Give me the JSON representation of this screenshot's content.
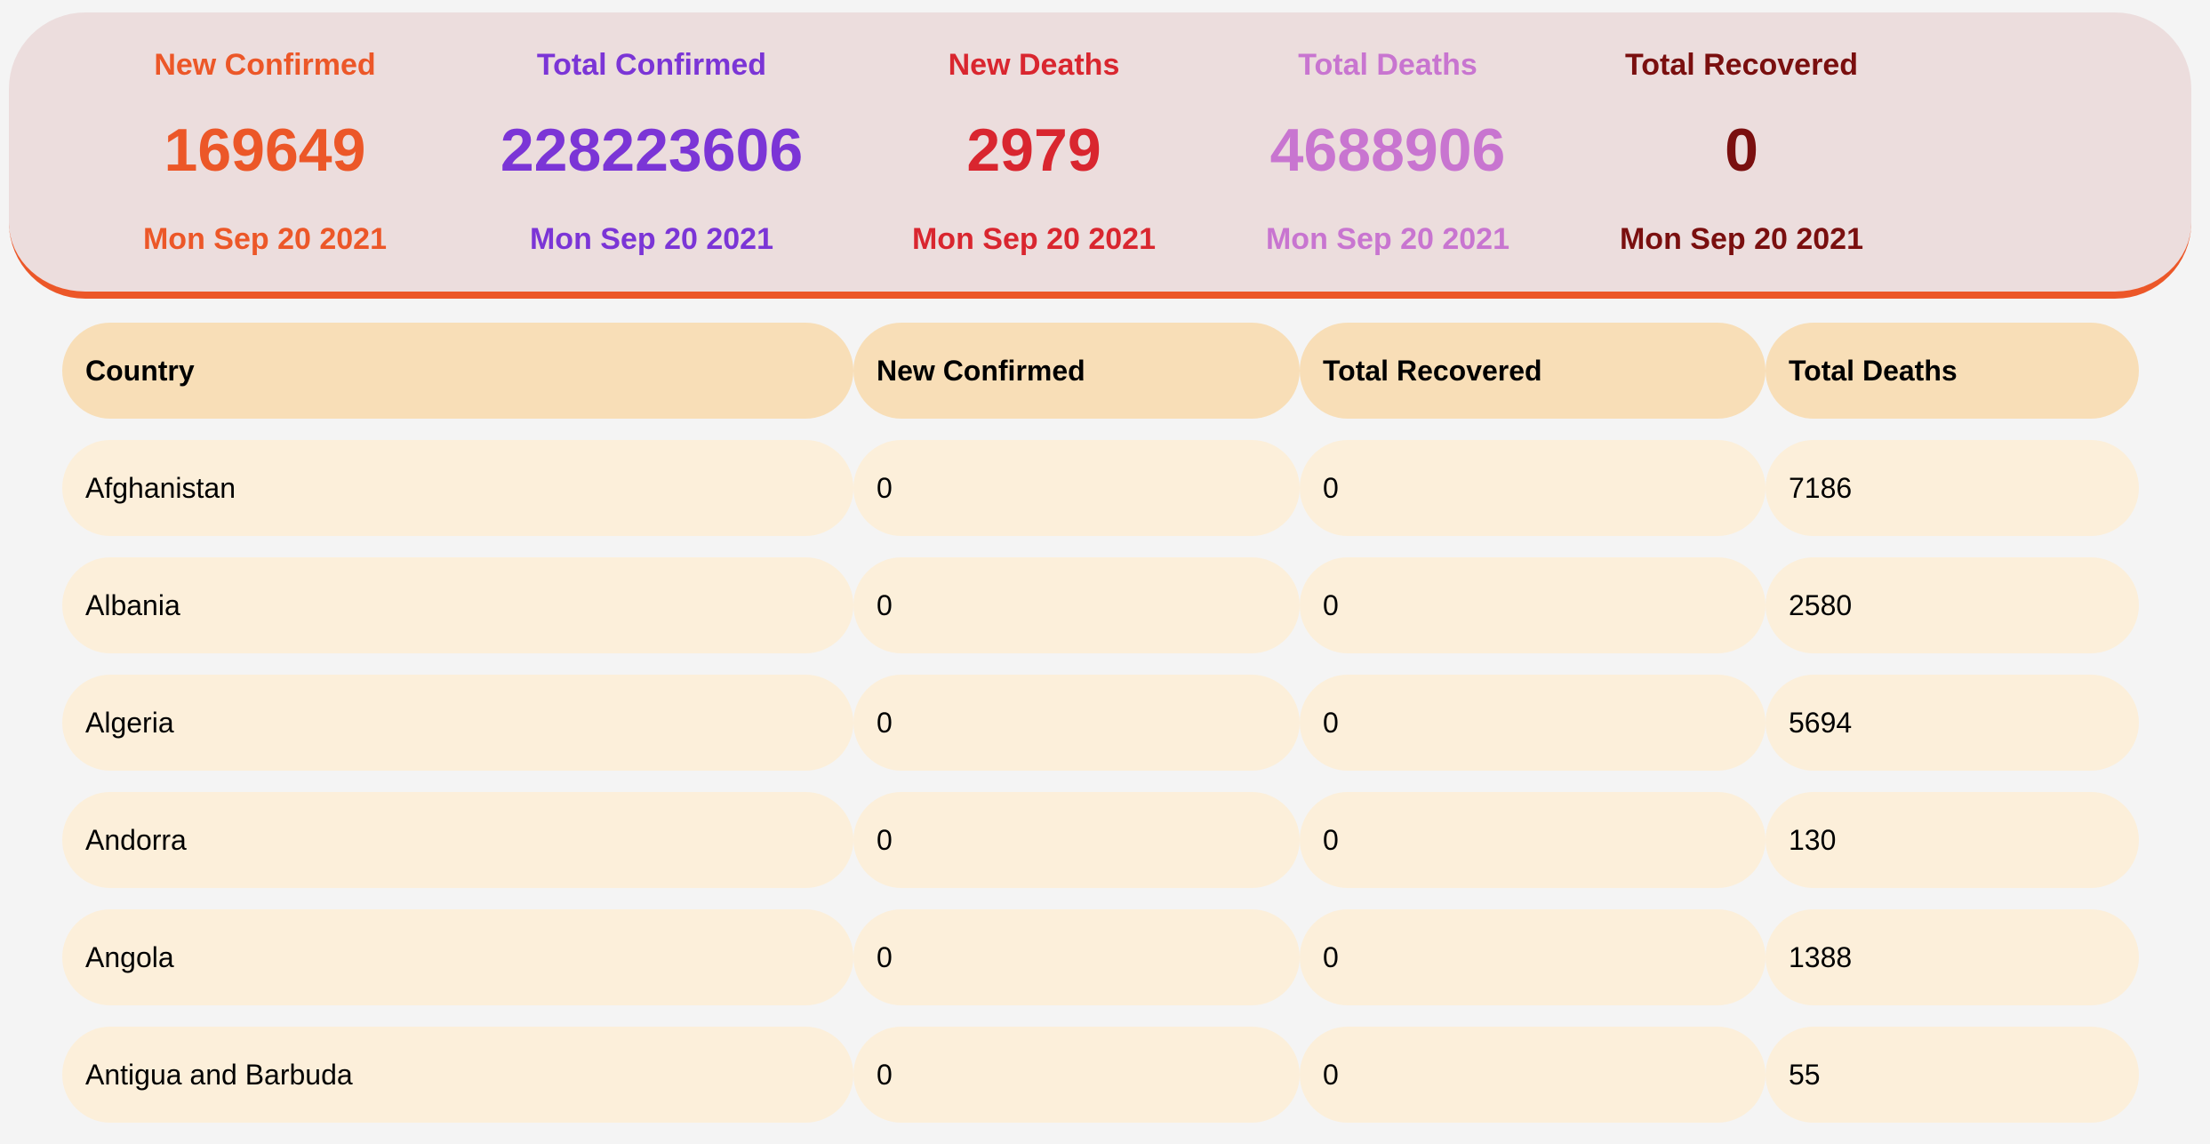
{
  "summary": {
    "stats": [
      {
        "label": "New Confirmed",
        "value": "169649",
        "date": "Mon Sep 20 2021",
        "color": "#ec5728"
      },
      {
        "label": "Total Confirmed",
        "value": "228223606",
        "date": "Mon Sep 20 2021",
        "color": "#7b35d6"
      },
      {
        "label": "New Deaths",
        "value": "2979",
        "date": "Mon Sep 20 2021",
        "color": "#d9262f"
      },
      {
        "label": "Total Deaths",
        "value": "4688906",
        "date": "Mon Sep 20 2021",
        "color": "#c875d0"
      },
      {
        "label": "Total Recovered",
        "value": "0",
        "date": "Mon Sep 20 2021",
        "color": "#7a0f0f"
      }
    ]
  },
  "table": {
    "columns": [
      "Country",
      "New Confirmed",
      "Total Recovered",
      "Total Deaths"
    ],
    "rows": [
      [
        "Afghanistan",
        "0",
        "0",
        "7186"
      ],
      [
        "Albania",
        "0",
        "0",
        "2580"
      ],
      [
        "Algeria",
        "0",
        "0",
        "5694"
      ],
      [
        "Andorra",
        "0",
        "0",
        "130"
      ],
      [
        "Angola",
        "0",
        "0",
        "1388"
      ],
      [
        "Antigua and Barbuda",
        "0",
        "0",
        "55"
      ]
    ]
  }
}
